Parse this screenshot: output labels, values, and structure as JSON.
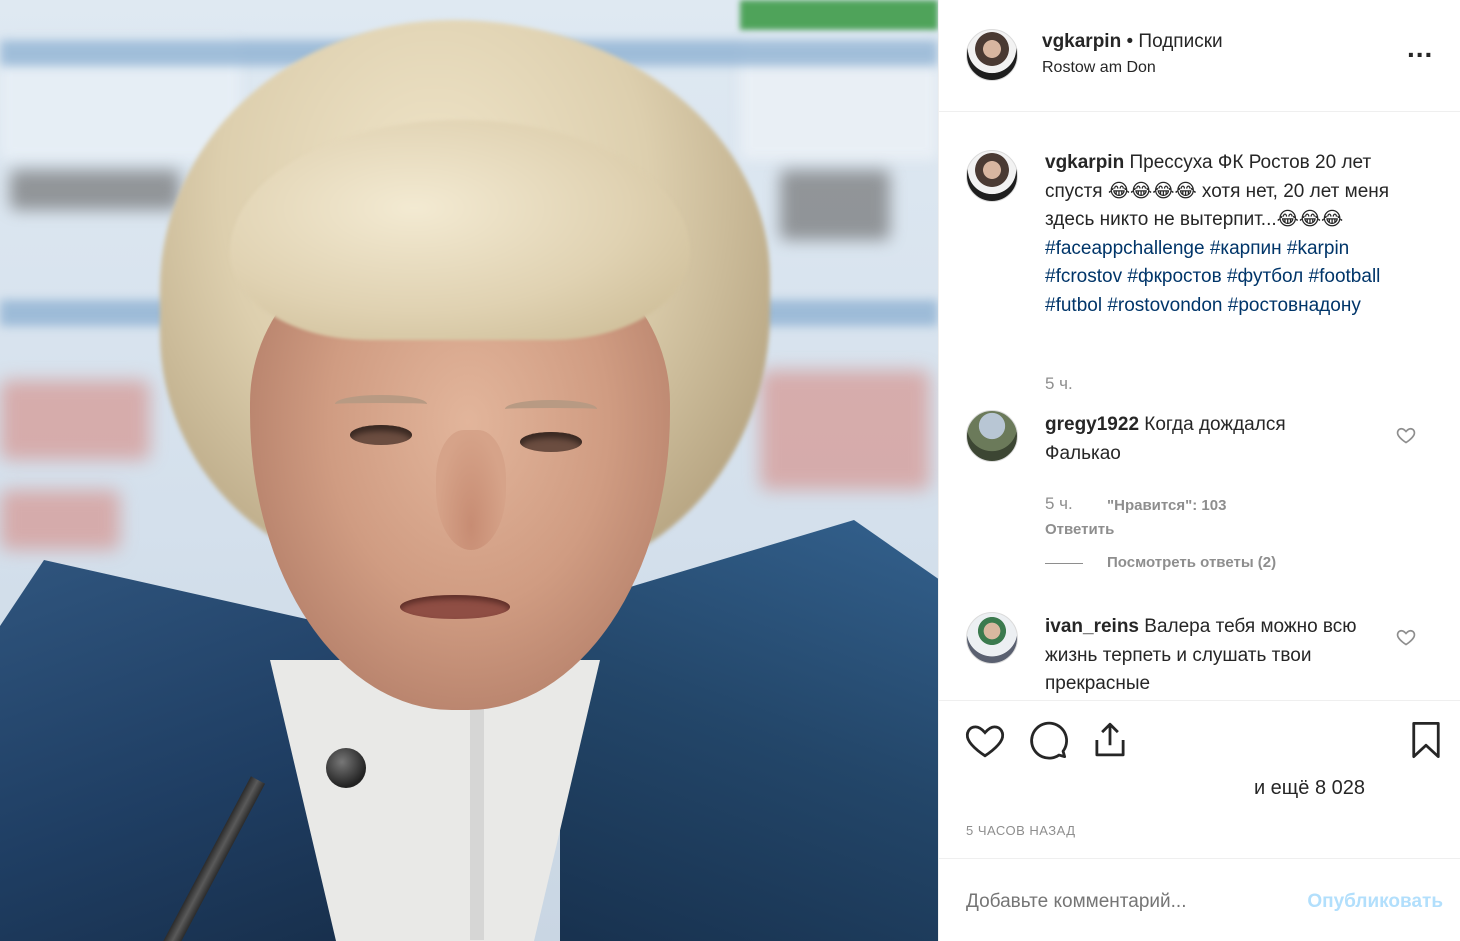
{
  "post": {
    "image_alt": "Фото",
    "author": "vgkarpin",
    "follow_label": " • Подписки",
    "location": "Rostow am Don",
    "more_label": "...",
    "caption": {
      "username": "vgkarpin",
      "text1": " Прессуха ФК Ростов 20 лет спустя 😂😂😂😂 хотя нет, 20 лет меня здесь никто не вытерпит...😂😂😂 ",
      "tags": [
        "#faceappchallenge",
        "#карпин",
        "#karpin",
        "#fcrostov",
        "#фкростов",
        "#футбол",
        "#football",
        "#futbol",
        "#rostovondon",
        "#ростовнадону"
      ],
      "time": "5 ч."
    },
    "comments": [
      {
        "username": "gregy1922",
        "text": " Когда дождался Фалькао",
        "time": "5 ч.",
        "likes": "\"Нравится\": 103",
        "reply_label": "Ответить",
        "view_replies": "Посмотреть ответы (2)"
      },
      {
        "username": "ivan_reins",
        "text": " Валера тебя можно всю жизнь терпеть и слушать твои прекрасные"
      }
    ],
    "likes_text": "и ещё 8 028",
    "posted_ago": "5 ЧАСОВ НАЗАД",
    "add_comment_placeholder": "Добавьте комментарий...",
    "publish_label": "Опубликовать"
  },
  "colors": {
    "hashtag": "#003569",
    "publish_disabled": "#b2dffc",
    "muted": "#8e8e8e"
  },
  "icons": [
    "more-options-icon",
    "heart-icon",
    "comment-icon",
    "share-icon",
    "bookmark-icon",
    "comment-like-heart-icon"
  ]
}
